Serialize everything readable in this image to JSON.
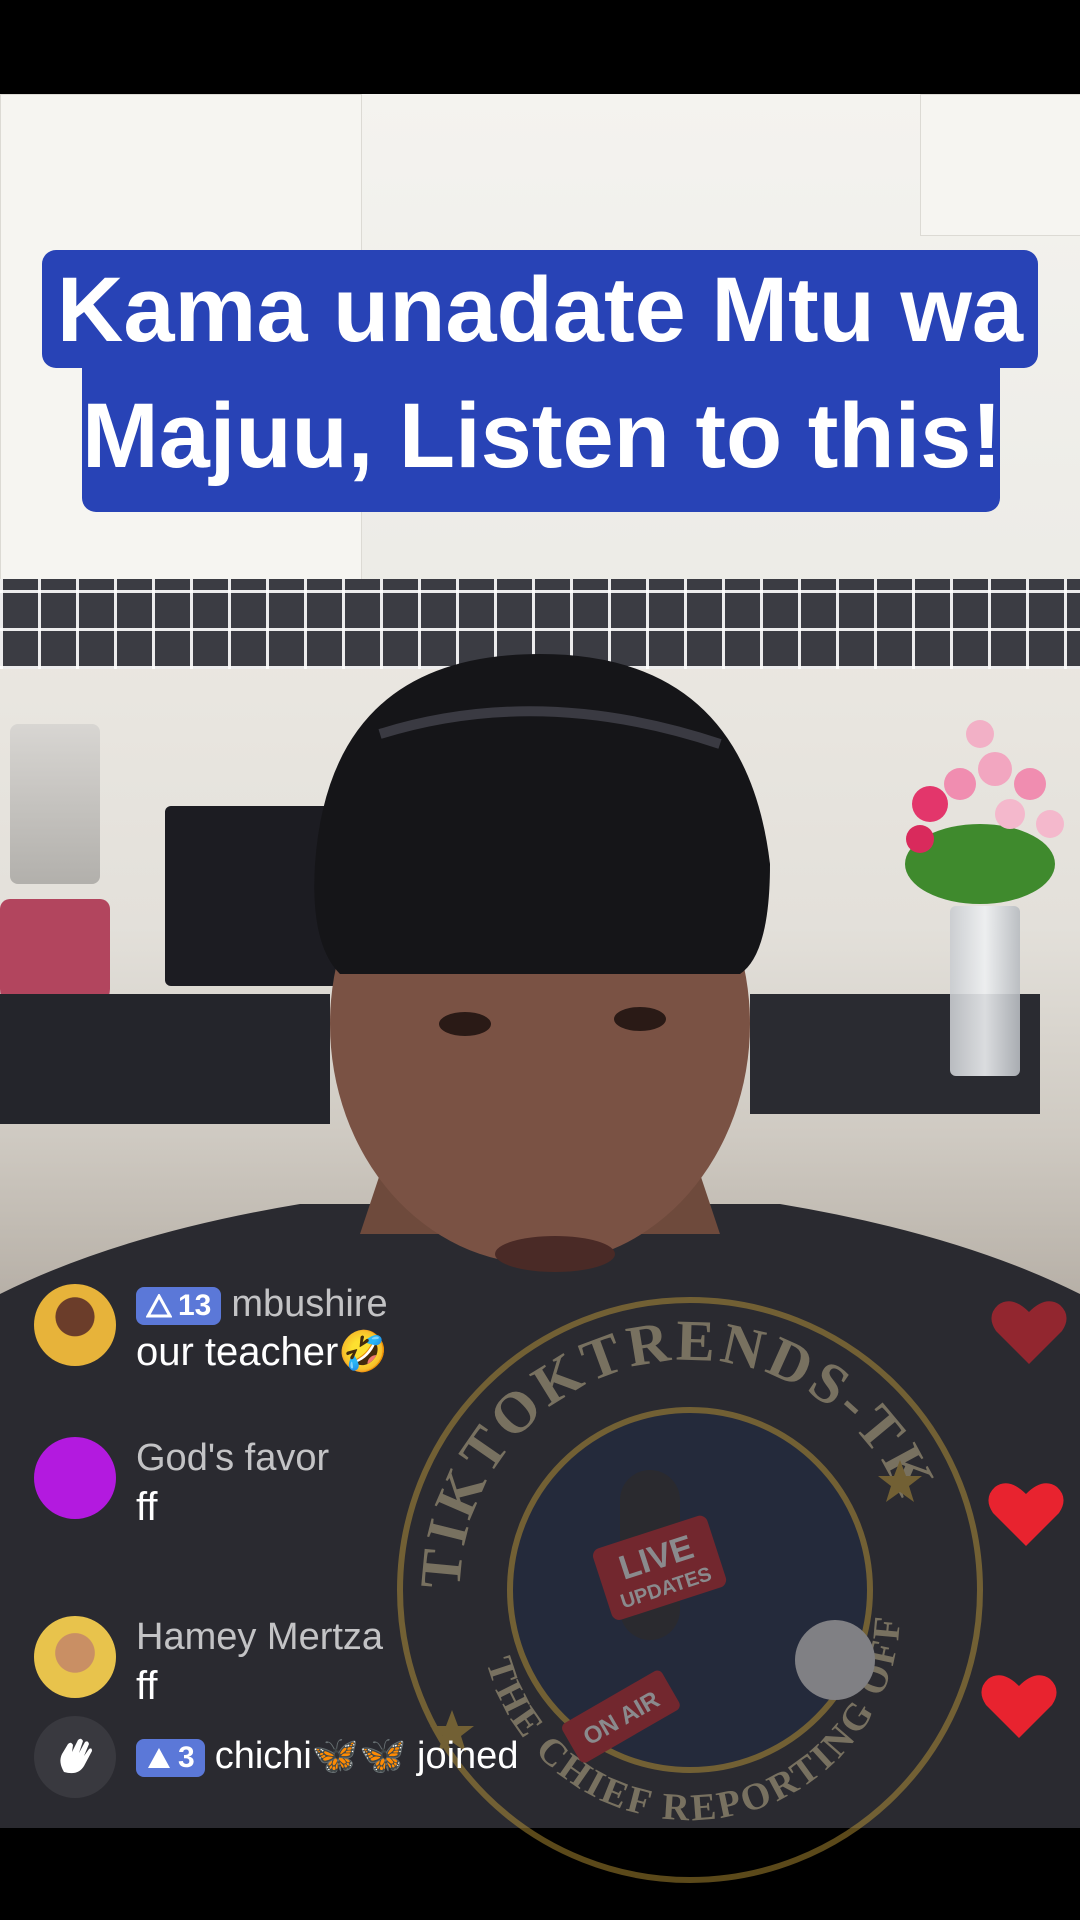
{
  "caption": {
    "line1": "Kama unadate Mtu wa",
    "line2": "Majuu, Listen to this!"
  },
  "comments": [
    {
      "level": "13",
      "name": "mbushire",
      "text": "our teacher🤣"
    },
    {
      "name": "God's favor",
      "text": "ff"
    },
    {
      "name": "Hamey Mertza",
      "text": "ff"
    }
  ],
  "join_event": {
    "level": "3",
    "name": "chichi🦋🦋",
    "action": "joined",
    "icon": "wave-hand-icon"
  },
  "watermark": {
    "arc_top": "TIKTOKTRENDS-TK",
    "arc_bottom": "THE CHIEF REPORTING OFFICER",
    "badge_line1": "LIVE",
    "badge_line2": "UPDATES",
    "on_air": "ON AIR"
  },
  "colors": {
    "caption_bg": "#2843b6",
    "heart": "#e8232f",
    "badge": "#5b78d8"
  }
}
